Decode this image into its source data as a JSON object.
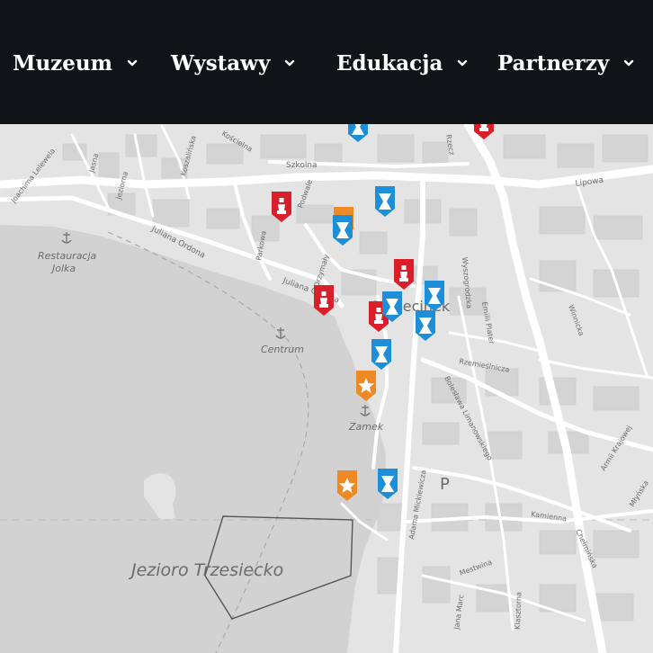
{
  "nav": {
    "items": [
      {
        "label": "Muzeum"
      },
      {
        "label": "Wystawy"
      },
      {
        "label": "Edukacja"
      },
      {
        "label": "Partnerzy"
      }
    ]
  },
  "map": {
    "labels": {
      "restauracja": "Restauracja",
      "jolka": "Jolka",
      "centrum": "Centrum",
      "zamek": "Zamek",
      "jezioro": "Jezioro Trzesiecko",
      "szczecinek": "Szczecinek",
      "parking": "P",
      "szkolna": "Szkolna",
      "lipowa": "Lipowa",
      "podwale": "Podwale",
      "parkowa": "Parkowa",
      "juliana_ordona": "Juliana Ordona",
      "juliana_ordona2": "Juliana Ordona",
      "drzymaly": "Drzymały",
      "jeziorna": "Jeziorna",
      "jasna": "Jasna",
      "koszalinska": "Koszalińska",
      "joachima": "Joachima Lelewela",
      "koscielna": "Kościelna",
      "wyszogrodzka": "Wyszogrodzka",
      "emilii_plater": "Emilii Plater",
      "rzemieslnicza": "Rzemieślnicza",
      "boleslawa": "Bolesława Limanowskiego",
      "adama": "Adama Mickiewicza",
      "kamienna": "Kamienna",
      "chelminska": "Chełmińska",
      "winnicka": "Winnicka",
      "armii": "Armii Krajowej",
      "mlynska": "Młyńska",
      "klasztorna": "Klasztorna",
      "mestwina": "Mestwina",
      "jana_marc": "Jana Marc",
      "rzecz": "Rzecz"
    },
    "markers": [
      {
        "type": "blue",
        "icon": "bowtie"
      },
      {
        "type": "red",
        "icon": "figure"
      },
      {
        "type": "red",
        "icon": "figure"
      },
      {
        "type": "orange",
        "icon": "star"
      },
      {
        "type": "blue",
        "icon": "bowtie"
      },
      {
        "type": "blue",
        "icon": "bowtie"
      },
      {
        "type": "red",
        "icon": "figure"
      },
      {
        "type": "red",
        "icon": "figure"
      },
      {
        "type": "blue",
        "icon": "bowtie"
      },
      {
        "type": "blue",
        "icon": "bowtie"
      },
      {
        "type": "red",
        "icon": "figure"
      },
      {
        "type": "blue",
        "icon": "bowtie"
      },
      {
        "type": "blue",
        "icon": "bowtie"
      },
      {
        "type": "orange",
        "icon": "star"
      },
      {
        "type": "orange",
        "icon": "star"
      },
      {
        "type": "blue",
        "icon": "bowtie"
      }
    ],
    "colors": {
      "blue": "#1d8fd8",
      "red": "#d91f2a",
      "orange": "#ee8a25",
      "water": "#cfcfcf",
      "land": "#e4e4e4",
      "road": "#ffffff",
      "nav_bg": "#111416"
    }
  }
}
